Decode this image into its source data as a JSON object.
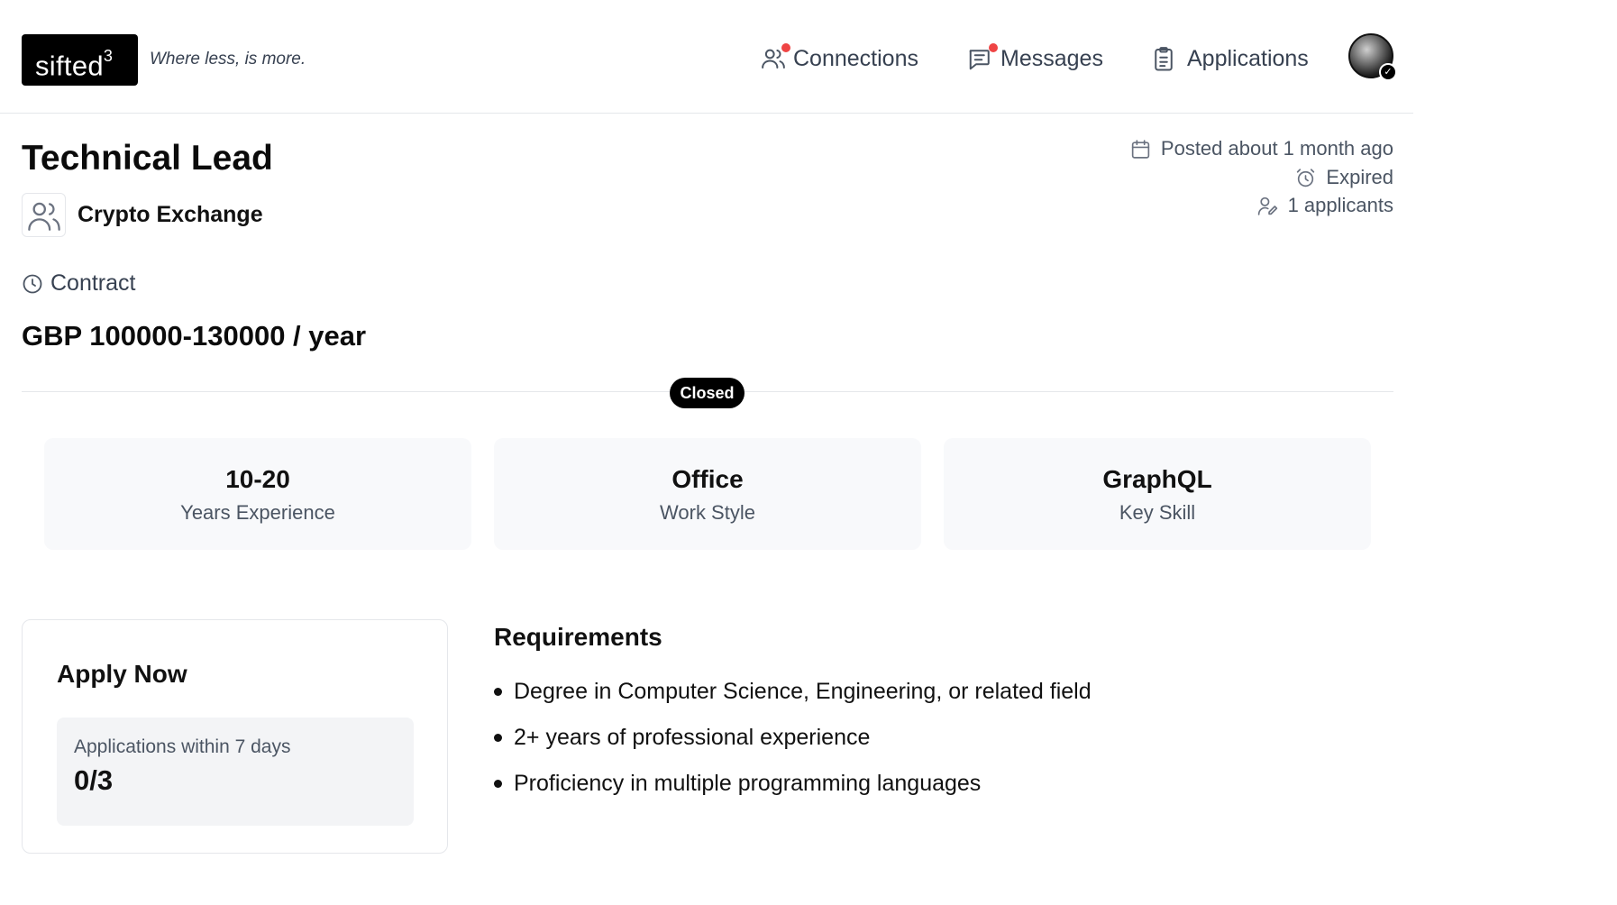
{
  "header": {
    "logo_text": "sifted",
    "logo_sup": "3",
    "tagline": "Where less, is more.",
    "nav": {
      "connections": "Connections",
      "messages": "Messages",
      "applications": "Applications"
    },
    "notification_color": "#ef4444"
  },
  "job": {
    "title": "Technical Lead",
    "company": "Crypto Exchange",
    "posted": "Posted about 1 month ago",
    "status_text": "Expired",
    "applicants": "1 applicants",
    "contract_type": "Contract",
    "salary": "GBP 100000-130000 / year",
    "badge": "Closed"
  },
  "stats": [
    {
      "value": "10-20",
      "label": "Years Experience"
    },
    {
      "value": "Office",
      "label": "Work Style"
    },
    {
      "value": "GraphQL",
      "label": "Key Skill"
    }
  ],
  "apply": {
    "title": "Apply Now",
    "limit_label": "Applications within 7 days",
    "limit_count": "0/3"
  },
  "requirements": {
    "title": "Requirements",
    "items": [
      "Degree in Computer Science, Engineering, or related field",
      "2+ years of professional experience",
      "Proficiency in multiple programming languages"
    ]
  },
  "icons": [
    "users-icon",
    "message-icon",
    "clipboard-icon",
    "calendar-icon",
    "alarm-clock-icon",
    "user-edit-icon",
    "clock-icon",
    "company-users-icon"
  ]
}
